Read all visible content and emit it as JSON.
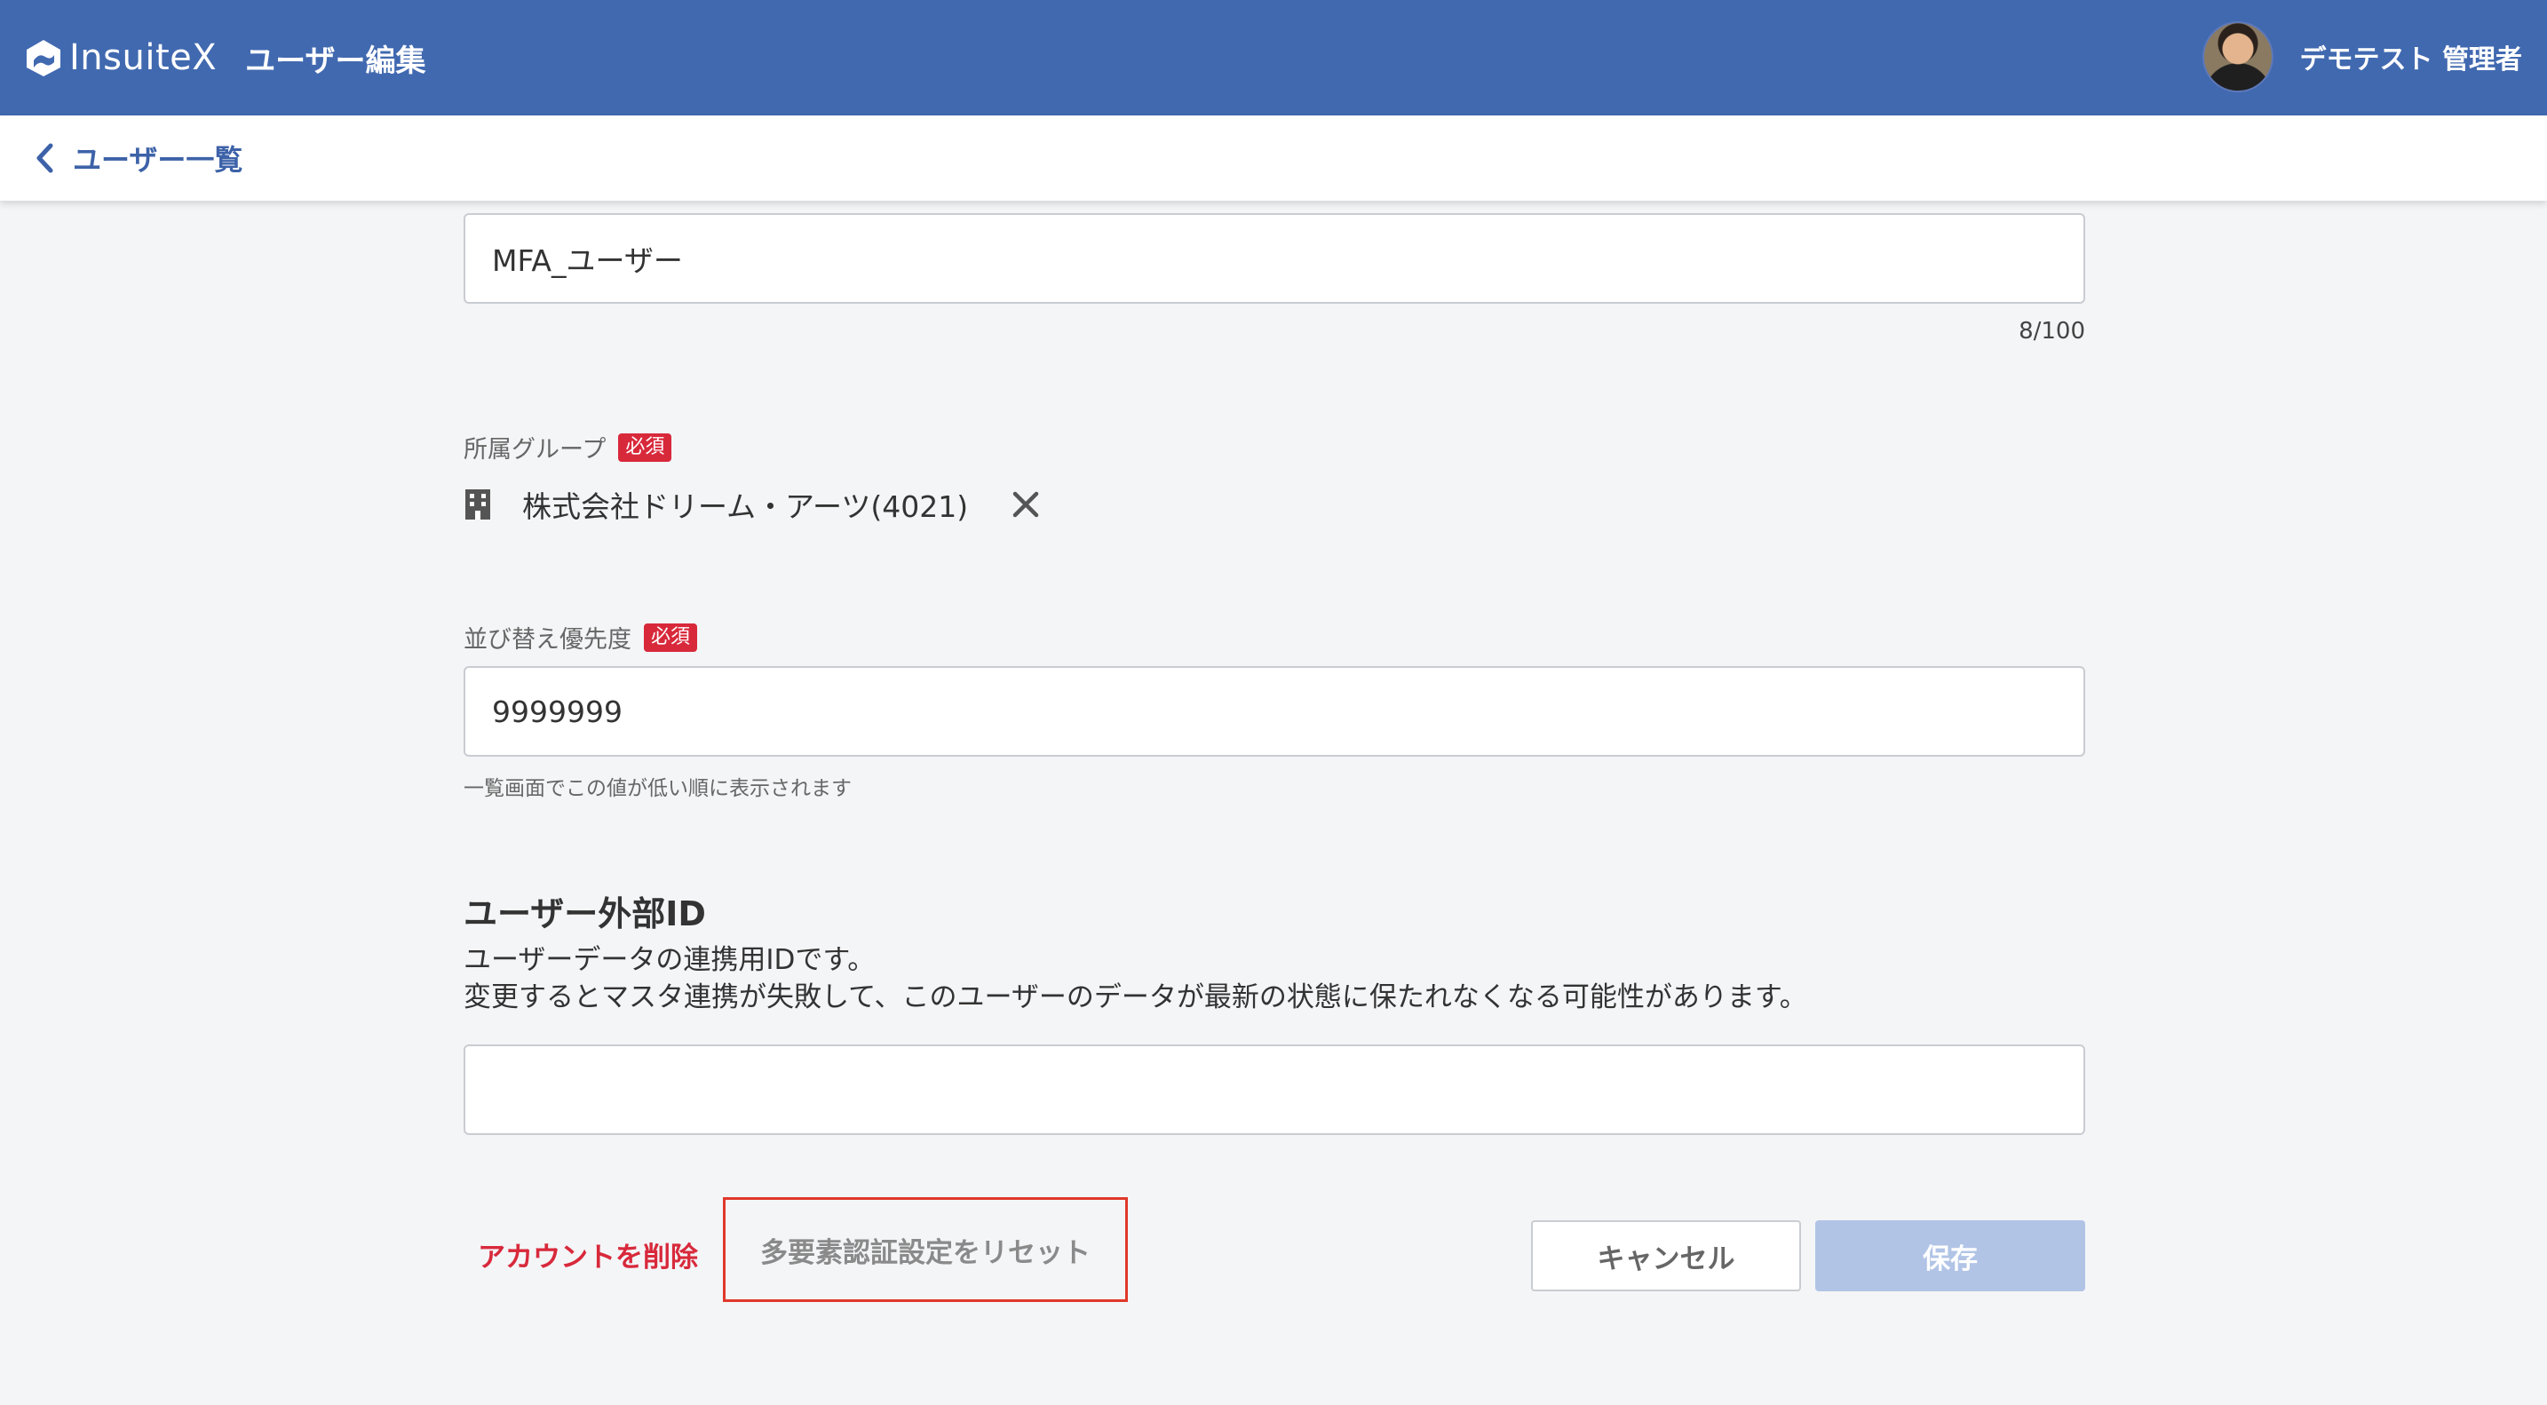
{
  "header": {
    "logo_text": "InsuiteX",
    "title": "ユーザー編集",
    "user_name": "デモテスト 管理者"
  },
  "subbar": {
    "back_label": "ユーザー一覧"
  },
  "form": {
    "name_field": {
      "value": "MFA_ユーザー",
      "counter": "8/100"
    },
    "group_field": {
      "label": "所属グループ",
      "required_badge": "必須",
      "selected_group": "株式会社ドリーム・アーツ(4021)"
    },
    "sort_priority_field": {
      "label": "並び替え優先度",
      "required_badge": "必須",
      "value": "9999999",
      "hint": "一覧画面でこの値が低い順に表示されます"
    },
    "external_id_section": {
      "title": "ユーザー外部ID",
      "description_line1": "ユーザーデータの連携用IDです。",
      "description_line2": "変更するとマスタ連携が失敗して、このユーザーのデータが最新の状態に保たれなくなる可能性があります。",
      "value": ""
    }
  },
  "actions": {
    "delete_account": "アカウントを削除",
    "reset_mfa": "多要素認証設定をリセット",
    "cancel": "キャンセル",
    "save": "保存"
  },
  "colors": {
    "header_bg": "#4169b0",
    "link_blue": "#3d62a8",
    "danger_red": "#d8293b",
    "highlight_border": "#e0382b",
    "disabled_save": "#b1c4e6"
  }
}
